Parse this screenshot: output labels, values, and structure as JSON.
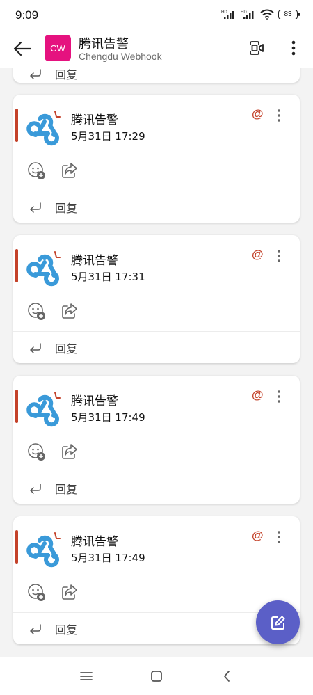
{
  "status_bar": {
    "time": "9:09",
    "battery": "83"
  },
  "header": {
    "avatar_initials": "CW",
    "title": "腾讯告警",
    "subtitle": "Chengdu Webhook",
    "avatar_color": "#e5127f"
  },
  "partial_card": {
    "reply_label": "回复"
  },
  "messages": [
    {
      "sender": "腾讯告警",
      "timestamp": "5月31日 17:29",
      "mention_symbol": "@",
      "reply_label": "回复"
    },
    {
      "sender": "腾讯告警",
      "timestamp": "5月31日 17:31",
      "mention_symbol": "@",
      "reply_label": "回复"
    },
    {
      "sender": "腾讯告警",
      "timestamp": "5月31日 17:49",
      "mention_symbol": "@",
      "reply_label": "回复"
    },
    {
      "sender": "腾讯告警",
      "timestamp": "5月31日 17:49",
      "mention_symbol": "@",
      "reply_label": "回复"
    }
  ],
  "icons": {
    "back": "arrow-left-icon",
    "meet": "video-call-icon",
    "more": "more-vertical-icon",
    "bot": "webhook-icon",
    "reaction": "emoji-add-icon",
    "share": "share-icon",
    "reply": "reply-arrow-icon",
    "compose": "compose-icon"
  },
  "colors": {
    "accent": "#c4422a",
    "fab": "#5b5fc7",
    "webhook": "#3a9ad9"
  }
}
